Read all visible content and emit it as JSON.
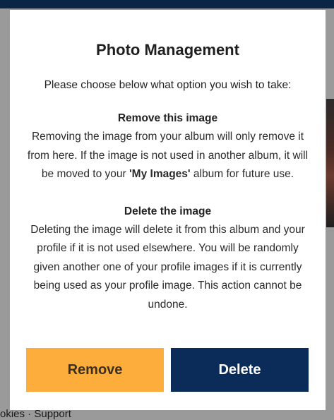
{
  "footer": {
    "text": "okies · Support"
  },
  "modal": {
    "title": "Photo Management",
    "intro": "Please choose below what option you wish to take:",
    "remove_section": {
      "heading": "Remove this image",
      "text_before": "Removing the image from your album will only remove it from here. If the image is not used in another album, it will be moved to your ",
      "highlight": "'My Images'",
      "text_after": " album for future use."
    },
    "delete_section": {
      "heading": "Delete the image",
      "text": "Deleting the image will delete it from this album and your profile if it is not used elsewhere. You will be randomly given another one of your profile images if it is currently being used as your profile image. This action cannot be undone."
    },
    "buttons": {
      "remove_label": "Remove",
      "delete_label": "Delete"
    }
  },
  "colors": {
    "remove_button": "#fdad3b",
    "delete_button": "#0b2c59",
    "top_bar": "#0b2546"
  }
}
